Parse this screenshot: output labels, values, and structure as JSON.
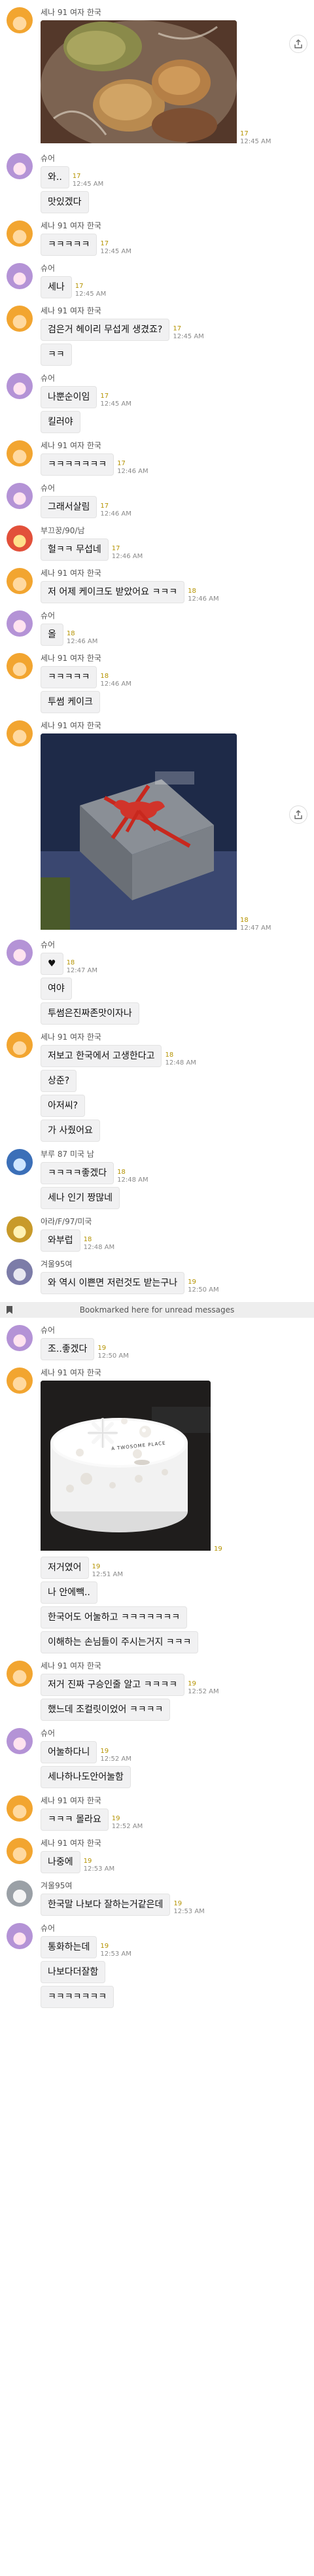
{
  "thread": [
    {
      "type": "photo",
      "sender": "세나 91 여자 한국",
      "avatar": "a",
      "photo": "food",
      "time": "12:45 AM",
      "read": "17",
      "share": true
    },
    {
      "type": "text",
      "sender": "슈어",
      "avatar": "b",
      "lines": [
        "와..",
        "맛있겠다"
      ],
      "time": "12:45 AM",
      "read": "17"
    },
    {
      "type": "text",
      "sender": "세나 91 여자 한국",
      "avatar": "a",
      "lines": [
        "ㅋㅋㅋㅋㅋ"
      ],
      "time": "12:45 AM",
      "read": "17"
    },
    {
      "type": "text",
      "sender": "슈어",
      "avatar": "b",
      "lines": [
        "세나"
      ],
      "time": "12:45 AM",
      "read": "17"
    },
    {
      "type": "text",
      "sender": "세나 91 여자 한국",
      "avatar": "a",
      "lines": [
        "검은거 헤이리 무섭게 생겼죠?",
        "ㅋㅋ"
      ],
      "time": "12:45 AM",
      "read": "17"
    },
    {
      "type": "text",
      "sender": "슈어",
      "avatar": "b",
      "lines": [
        "나뿐순이임",
        "킬러야"
      ],
      "time": "12:45 AM",
      "read": "17"
    },
    {
      "type": "text",
      "sender": "세나 91 여자 한국",
      "avatar": "a",
      "lines": [
        "ㅋㅋㅋㅋㅋㅋㅋ"
      ],
      "time": "12:46 AM",
      "read": "17"
    },
    {
      "type": "text",
      "sender": "슈어",
      "avatar": "b",
      "lines": [
        "그래서살림"
      ],
      "time": "12:46 AM",
      "read": "17"
    },
    {
      "type": "text",
      "sender": "부끄꿍/90/남",
      "avatar": "c",
      "lines": [
        "헐ㅋㅋ 무섭네"
      ],
      "time": "12:46 AM",
      "read": "17"
    },
    {
      "type": "text",
      "sender": "세나 91 여자 한국",
      "avatar": "a",
      "lines": [
        "저 어제 케이크도 받았어요 ㅋㅋㅋ"
      ],
      "time": "12:46 AM",
      "read": "18"
    },
    {
      "type": "text",
      "sender": "슈어",
      "avatar": "b",
      "lines": [
        "올"
      ],
      "time": "12:46 AM",
      "read": "18"
    },
    {
      "type": "text",
      "sender": "세나 91 여자 한국",
      "avatar": "a",
      "lines": [
        "ㅋㅋㅋㅋㅋ",
        "투썸 케이크"
      ],
      "time": "12:46 AM",
      "read": "18"
    },
    {
      "type": "photo",
      "sender": "세나 91 여자 한국",
      "avatar": "a",
      "photo": "giftbox",
      "time": "12:47 AM",
      "read": "18",
      "share": true
    },
    {
      "type": "text",
      "sender": "슈어",
      "avatar": "b",
      "lines": [
        "♥",
        "여야",
        "투썸은진짜존맛이자나"
      ],
      "time": "12:47 AM",
      "read": "18"
    },
    {
      "type": "text",
      "sender": "세나 91 여자 한국",
      "avatar": "a",
      "lines": [
        "저보고 한국에서 고생한다고",
        "상준?",
        "아저씨?",
        "가 사줬어요"
      ],
      "time": "12:48 AM",
      "read": "18"
    },
    {
      "type": "text",
      "sender": "부루 87 미국 남",
      "avatar": "d",
      "lines": [
        "ㅋㅋㅋㅋ좋겠다",
        "세나 인기 짱많네"
      ],
      "time": "12:48 AM",
      "read": "18"
    },
    {
      "type": "text",
      "sender": "아라/F/97/미국",
      "avatar": "e",
      "lines": [
        "와부럽"
      ],
      "time": "12:48 AM",
      "read": "18"
    },
    {
      "type": "text",
      "sender": "겨울95여",
      "avatar": "f",
      "lines": [
        "와 역시 이쁜면 저런것도 받는구나"
      ],
      "time": "12:50 AM",
      "read": "19"
    },
    {
      "type": "bookmark",
      "text": "Bookmarked here for unread messages"
    },
    {
      "type": "text",
      "sender": "슈어",
      "avatar": "b",
      "lines": [
        "조..좋겠다"
      ],
      "time": "12:50 AM",
      "read": "19"
    },
    {
      "type": "photo",
      "sender": "세나 91 여자 한국",
      "avatar": "a",
      "photo": "cake",
      "cake_label": "A TWOSOME PLACE",
      "time": "",
      "read": "19",
      "share": false
    },
    {
      "type": "text",
      "sender": "",
      "avatar": "",
      "lines": [
        "저거였어",
        "나 안에빽..",
        "한국어도 어눌하고 ㅋㅋㅋㅋㅋㅋㅋ",
        "이해하는 손님들이 주시는거지 ㅋㅋㅋ"
      ],
      "time": "12:51 AM",
      "read": "19"
    },
    {
      "type": "text",
      "sender": "세나 91 여자 한국",
      "avatar": "a",
      "lines": [
        "저거 진짜 구승인줄 알고 ㅋㅋㅋㅋ",
        "했느데 조컬릿이었어 ㅋㅋㅋㅋ"
      ],
      "time": "12:52 AM",
      "read": "19"
    },
    {
      "type": "text",
      "sender": "슈어",
      "avatar": "b",
      "lines": [
        "어눌하다니",
        "세나하나도안어눌함"
      ],
      "time": "12:52 AM",
      "read": "19"
    },
    {
      "type": "text",
      "sender": "세나 91 여자 한국",
      "avatar": "a",
      "lines": [
        "ㅋㅋㅋ 몰라요"
      ],
      "time": "12:52 AM",
      "read": "19"
    },
    {
      "type": "text",
      "sender": "세나 91 여자 한국",
      "avatar": "a",
      "lines": [
        "나중에"
      ],
      "time": "12:53 AM",
      "read": "19"
    },
    {
      "type": "text",
      "sender": "겨울95여",
      "avatar": "g",
      "lines": [
        "한국말 나보다 잘하는거같은데"
      ],
      "time": "12:53 AM",
      "read": "19"
    },
    {
      "type": "text",
      "sender": "슈어",
      "avatar": "b",
      "lines": [
        "통화하는데",
        "나보다더잘함",
        "ㅋㅋㅋㅋㅋㅋㅋ"
      ],
      "time": "12:53 AM",
      "read": "19"
    }
  ]
}
